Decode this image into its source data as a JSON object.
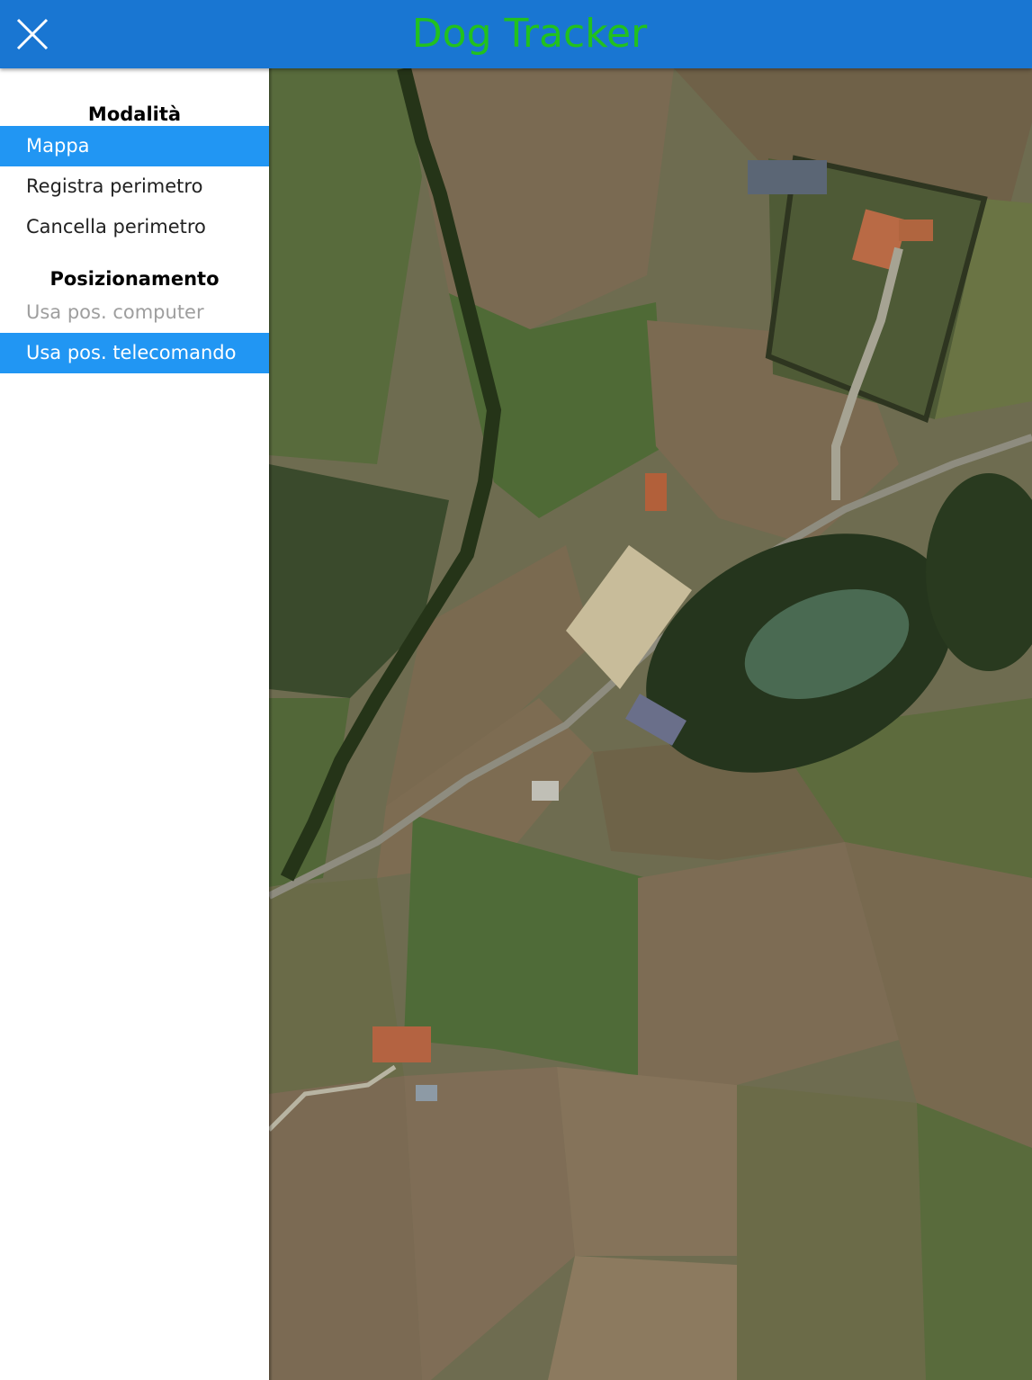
{
  "header": {
    "title": "Dog Tracker",
    "close_icon": "close-icon"
  },
  "sidebar": {
    "modes": {
      "title": "Modalità",
      "items": [
        {
          "label": "Mappa",
          "active": true
        },
        {
          "label": "Registra perimetro",
          "active": false
        },
        {
          "label": "Cancella perimetro",
          "active": false
        }
      ]
    },
    "positioning": {
      "title": "Posizionamento",
      "items": [
        {
          "label": "Usa pos. computer",
          "active": false,
          "disabled": true
        },
        {
          "label": "Usa pos. telecomando",
          "active": true
        }
      ]
    }
  },
  "colors": {
    "header_bg": "#1976d2",
    "title": "#22c11e",
    "active_item": "#2196f3"
  }
}
